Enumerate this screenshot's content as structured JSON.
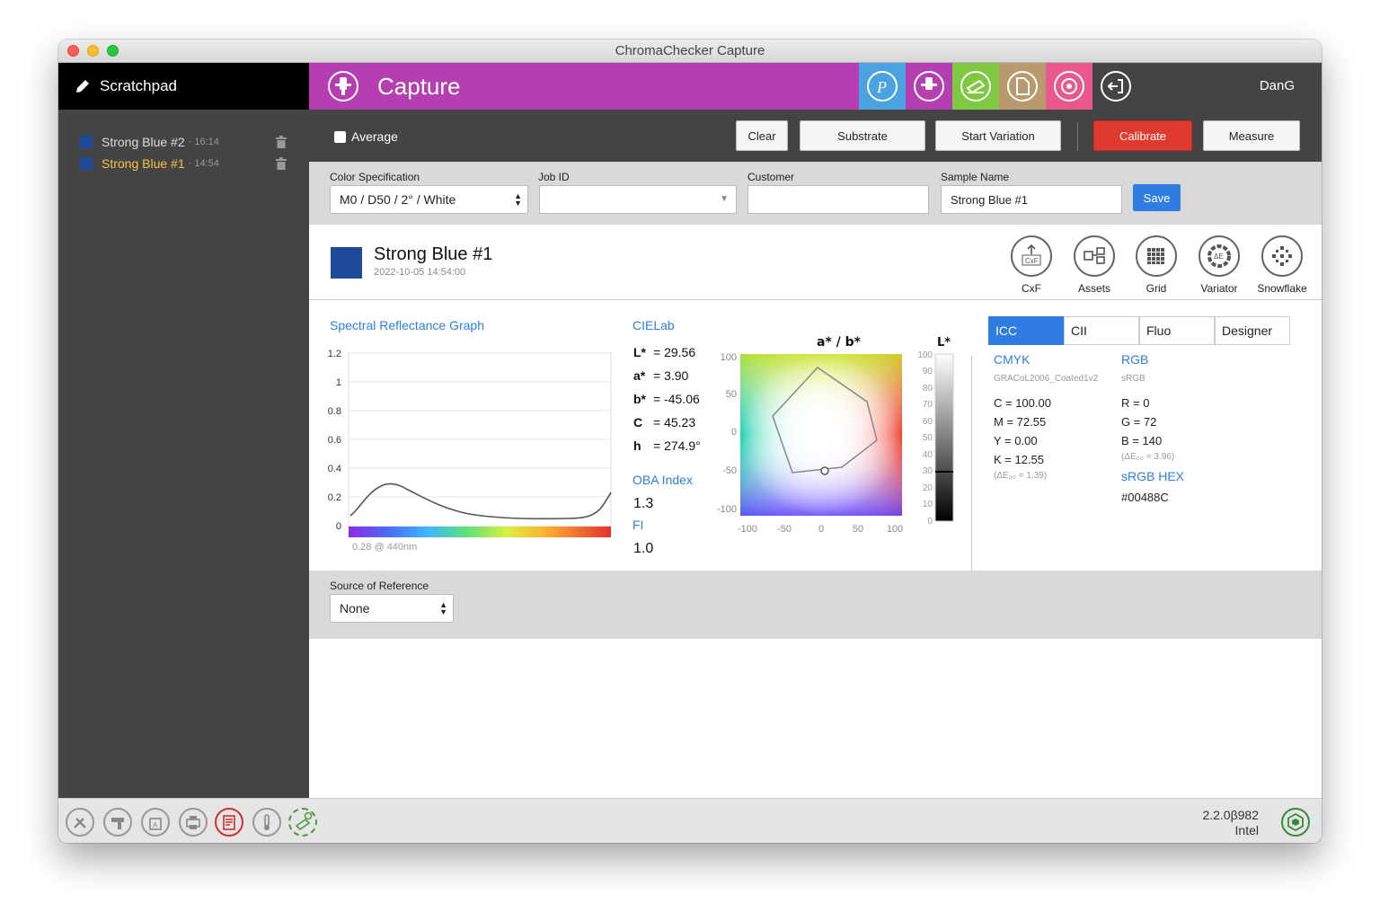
{
  "window": {
    "title": "ChromaChecker Capture"
  },
  "sidebar": {
    "title": "Scratchpad",
    "items": [
      {
        "name": "Strong Blue #2",
        "time": "· 16:14"
      },
      {
        "name": "Strong Blue #1",
        "time": "· 14:54"
      }
    ]
  },
  "header": {
    "title": "Capture",
    "user": "DanG",
    "tile_colors": [
      "#4aa3e0",
      "#b53fb0",
      "#7fc842",
      "#b89a6e",
      "#e8588e"
    ]
  },
  "toolbar": {
    "average_label": "Average",
    "clear": "Clear",
    "substrate": "Substrate",
    "start_variation": "Start Variation",
    "calibrate": "Calibrate",
    "measure": "Measure"
  },
  "fields": {
    "color_spec_label": "Color Specification",
    "color_spec_value": "M0 / D50 / 2° / White",
    "job_id_label": "Job ID",
    "job_id_value": "",
    "customer_label": "Customer",
    "customer_value": "",
    "sample_name_label": "Sample Name",
    "sample_name_value": "Strong Blue #1",
    "save": "Save"
  },
  "sample": {
    "name": "Strong Blue #1",
    "date": "2022-10-05 14:54:00",
    "color": "#1d4a9a"
  },
  "tools": [
    "CxF",
    "Assets",
    "Grid",
    "Variator",
    "Snowflake"
  ],
  "spectral": {
    "title": "Spectral Reflectance Graph",
    "y_ticks": [
      "1.2",
      "1",
      "0.8",
      "0.6",
      "0.4",
      "0.2",
      "0"
    ],
    "caption": "0.28 @ 440nm"
  },
  "cielab": {
    "title": "CIELab",
    "rows": [
      {
        "k": "L*",
        "v": "= 29.56"
      },
      {
        "k": "a*",
        "v": "= 3.90"
      },
      {
        "k": "b*",
        "v": "= -45.06"
      },
      {
        "k": "C",
        "v": "= 45.23"
      },
      {
        "k": "h",
        "v": "= 274.9°"
      }
    ],
    "oba_label": "OBA Index",
    "oba_value": "1.3",
    "fi_label": "FI",
    "fi_value": "1.0"
  },
  "ab_plot": {
    "title": "a* / b*",
    "y_ticks": [
      "100",
      "50",
      "0",
      "-50",
      "-100"
    ],
    "x_ticks": [
      "-100",
      "-50",
      "0",
      "50",
      "100"
    ],
    "l_title": "L*",
    "l_ticks": [
      "100",
      "90",
      "80",
      "70",
      "60",
      "50",
      "40",
      "30",
      "20",
      "10",
      "0"
    ]
  },
  "icc": {
    "tabs": [
      "ICC",
      "CII",
      "Fluo",
      "Designer"
    ],
    "cmyk_title": "CMYK",
    "cmyk_profile": "GRACoL2006_Coated1v2",
    "cmyk": [
      "C = 100.00",
      "M = 72.55",
      "Y = 0.00",
      "K = 12.55"
    ],
    "cmyk_de": "(ΔE₀₀ = 1.39)",
    "rgb_title": "RGB",
    "rgb_profile": "sRGB",
    "rgb": [
      "R = 0",
      "G = 72",
      "B = 140"
    ],
    "rgb_de": "(ΔE₀₀ = 3.96)",
    "hex_title": "sRGB HEX",
    "hex_value": "#00488C"
  },
  "reference": {
    "label": "Source of Reference",
    "value": "None"
  },
  "footer": {
    "version": "2.2.0β982",
    "arch": "Intel"
  }
}
